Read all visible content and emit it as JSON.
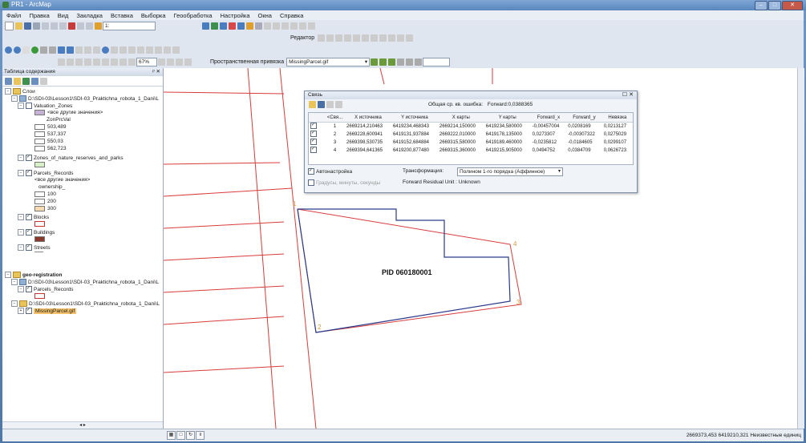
{
  "window": {
    "title": "PR1 - ArcMap"
  },
  "menu": [
    "Файл",
    "Правка",
    "Вид",
    "Закладка",
    "Вставка",
    "Выборка",
    "Геообработка",
    "Настройка",
    "Окна",
    "Справка"
  ],
  "toolbar": {
    "editor_label": "Редактор",
    "scale_value": "1:",
    "zoom_value": "67%",
    "georef_label": "Пространственная привязка",
    "georef_layer": "MissingParcel.gif"
  },
  "toc": {
    "title": "Таблица содержания",
    "pin": "ᵖ ✕",
    "root_layers": "Слои",
    "geo_group": "geo-registration",
    "path_lesson": "D:\\SDI-03\\Lesson1\\SDI-03_Praktichna_robota_1_Dani\\L",
    "valuation_zones": "Valuation_Zones",
    "other_values": "<все другие значения>",
    "zone_field": "ZonPrcVal",
    "zone_values": [
      "503,489",
      "537,337",
      "550,03",
      "562,723"
    ],
    "nature_reserves": "Zones_of_nature_reserves_and_parks",
    "parcels_records": "Parcels_Records",
    "ownership_field": "ownership_",
    "ownership_values": [
      "100",
      "200",
      "300"
    ],
    "blocks": "Blocks",
    "buildings": "Buildings",
    "streets": "Streets",
    "missing_parcel": "MissingParcel.gif"
  },
  "links_dialog": {
    "title": "Связь",
    "rms_label": "Общая ср. кв. ошибка:",
    "rms_value": "Forward:0,0388365",
    "columns": [
      "<Свя...",
      "X источника",
      "Y источника",
      "X карты",
      "Y карты",
      "Forward_x",
      "Forward_y",
      "Невязка"
    ],
    "rows": [
      [
        "1",
        "2669214,210463",
        "6419234,468343",
        "2669214,150000",
        "6419234,580000",
        "-0,00457004",
        "0,0208169",
        "0,0213127"
      ],
      [
        "2",
        "2669228,600941",
        "6419131,937884",
        "2669222,010000",
        "6419178,135000",
        "0,0273307",
        "-0,00307322",
        "0,0275029"
      ],
      [
        "3",
        "2669398,530735",
        "6419152,684884",
        "2669315,580000",
        "6419189,460000",
        "-0,0235812",
        "-0,0184605",
        "0,0299107"
      ],
      [
        "4",
        "2669394,641365",
        "6419200,877480",
        "2669315,360000",
        "6419215,905000",
        "0,0494752",
        "0,0384709",
        "0,0626723"
      ]
    ],
    "auto_adjust": "Автонастройка",
    "transform_label": "Трансформация:",
    "transform_value": "Полином 1-го порядка (Аффинное)",
    "dms_label": "Градусы, минуты, секунды",
    "residual_unit": "Forward Residual Unit : Unknown"
  },
  "map": {
    "parcel_label": "PID  060180001",
    "point_labels": [
      "1",
      "2",
      "3",
      "4"
    ]
  },
  "status": {
    "coords": "2669373,453  6419210,321 Неизвестные единиц"
  },
  "colors": {
    "map_lines": "#d93b3b",
    "parcel_outline": "#2a3a8a",
    "link_markers": "#d89a3a"
  }
}
